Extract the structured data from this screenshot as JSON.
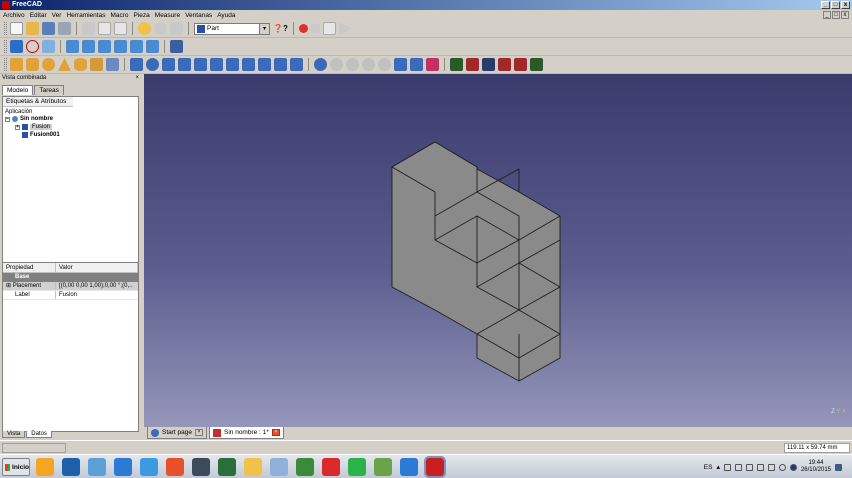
{
  "window": {
    "title": "FreeCAD",
    "controls": [
      "_",
      "□",
      "x"
    ]
  },
  "menu": [
    "Archivo",
    "Editar",
    "Ver",
    "Herramientas",
    "Macro",
    "Pieza",
    "Measure",
    "Ventanas",
    "Ayuda"
  ],
  "mdi_controls": [
    "_",
    "□",
    "x"
  ],
  "toolbar": {
    "workbench": "Part",
    "whats_this": "❓?"
  },
  "combo_view": {
    "title": "Vista combinada",
    "close_glyph": "×",
    "tabs": [
      "Modelo",
      "Tareas"
    ],
    "tree_header": "Etiquetas & Atributos",
    "tree_root": "Aplicación",
    "document": "Sin nombre",
    "items": [
      {
        "label": "Fusion",
        "selected": true
      },
      {
        "label": "Fusion001",
        "selected": false
      }
    ],
    "props_header": [
      "Propiedad",
      "Valor"
    ],
    "props_group": "Base",
    "props": [
      {
        "key": "Placement",
        "value": "[(0,00 0,00 1,00);0,00 °;(0,...",
        "selected": true
      },
      {
        "key": "Label",
        "value": "Fusion",
        "selected": false
      }
    ],
    "bottom_tabs": [
      "Vista",
      "Datos"
    ]
  },
  "doc_tabs": [
    {
      "label": "Start page",
      "active": false
    },
    {
      "label": "Sin nombre : 1*",
      "active": true
    }
  ],
  "status": {
    "dimensions": "119.11 x 59.74 mm"
  },
  "axis": {
    "y": "Y",
    "x": "X",
    "z": "Z"
  },
  "taskbar": {
    "start": "Inicio",
    "language": "ES",
    "time": "19:44",
    "date": "26/10/2015",
    "icon_colors": [
      "#f4a623",
      "#1d5fa8",
      "#5ca0d8",
      "#2b7bd6",
      "#3a9be0",
      "#e8502b",
      "#3d4a5a",
      "#2a6e3a",
      "#f0c24a",
      "#8fb0d8",
      "#3a8a3a",
      "#d92b2b",
      "#2bb34a",
      "#6aa34a",
      "#2b7bd6",
      "#c81e1e"
    ]
  },
  "colors": {
    "view_top": "#3a3b6b",
    "view_bottom": "#9596ba",
    "solid": "#8a8a8a"
  }
}
